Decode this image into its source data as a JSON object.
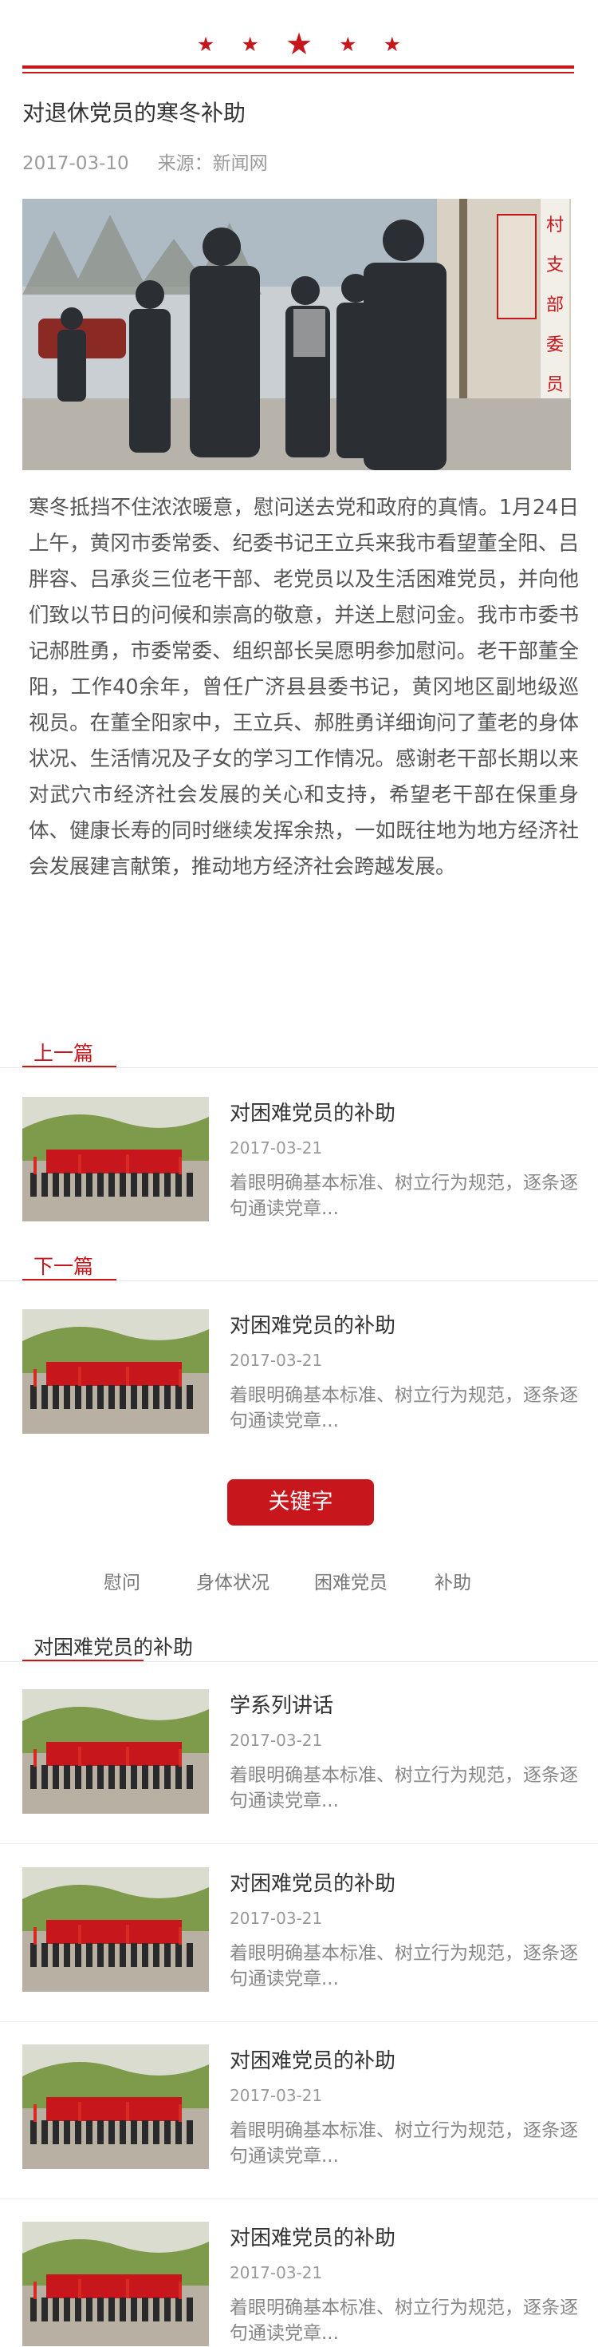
{
  "header": {
    "stars": [
      "★",
      "★",
      "★",
      "★",
      "★"
    ]
  },
  "article": {
    "title": "对退休党员的寒冬补助",
    "date": "2017-03-10",
    "source": "来源：新闻网",
    "body": "寒冬抵挡不住浓浓暖意，慰问送去党和政府的真情。1月24日上午，黄冈市委常委、纪委书记王立兵来我市看望董全阳、吕胖容、吕承炎三位老干部、老党员以及生活困难党员，并向他们致以节日的问候和崇高的敬意，并送上慰问金。我市市委书记郝胜勇，市委常委、组织部长吴愿明参加慰问。老干部董全阳，工作40余年，曾任广济县县委书记，黄冈地区副地级巡视员。在董全阳家中，王立兵、郝胜勇详细询问了董老的身体状况、生活情况及子女的学习工作情况。感谢老干部长期以来对武穴市经济社会发展的关心和支持，希望老干部在保重身体、健康长寿的同时继续发挥余热，一如既往地为地方经济社会发展建言献策，推动地方经济社会跨越发展。"
  },
  "prev": {
    "label": "上一篇",
    "item": {
      "title": "对困难党员的补助",
      "date": "2017-03-21",
      "summary": "着眼明确基本标准、树立行为规范，逐条逐句通读党章..."
    }
  },
  "next": {
    "label": "下一篇",
    "item": {
      "title": "对困难党员的补助",
      "date": "2017-03-21",
      "summary": "着眼明确基本标准、树立行为规范，逐条逐句通读党章..."
    }
  },
  "keywords": {
    "button": "关键字",
    "tags": [
      "慰问",
      "身体状况",
      "困难党员",
      "补助"
    ]
  },
  "related": {
    "label": "对困难党员的补助",
    "items": [
      {
        "title": "学系列讲话",
        "date": "2017-03-21",
        "summary": "着眼明确基本标准、树立行为规范，逐条逐句通读党章..."
      },
      {
        "title": "对困难党员的补助",
        "date": "2017-03-21",
        "summary": "着眼明确基本标准、树立行为规范，逐条逐句通读党章..."
      },
      {
        "title": "对困难党员的补助",
        "date": "2017-03-21",
        "summary": "着眼明确基本标准、树立行为规范，逐条逐句通读党章..."
      },
      {
        "title": "对困难党员的补助",
        "date": "2017-03-21",
        "summary": "着眼明确基本标准、树立行为规范，逐条逐句通读党章..."
      }
    ]
  },
  "colors": {
    "accent": "#c8161d",
    "text": "#333333",
    "muted": "#999999"
  }
}
